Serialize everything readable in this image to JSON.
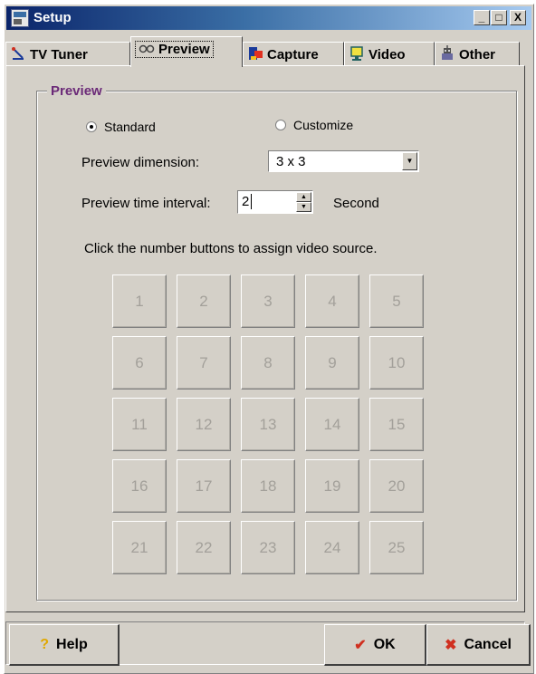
{
  "window": {
    "title": "Setup"
  },
  "titlebar_buttons": {
    "minimize": "_",
    "maximize": "□",
    "close": "X"
  },
  "tabs": [
    {
      "label": "TV Tuner",
      "icon": "antenna-icon",
      "active": false
    },
    {
      "label": "Preview",
      "icon": "glasses-icon",
      "active": true
    },
    {
      "label": "Capture",
      "icon": "capture-icon",
      "active": false
    },
    {
      "label": "Video",
      "icon": "monitor-icon",
      "active": false
    },
    {
      "label": "Other",
      "icon": "robot-icon",
      "active": false
    }
  ],
  "preview": {
    "group_title": "Preview",
    "radio_standard": "Standard",
    "radio_customize": "Customize",
    "selected_mode": "Standard",
    "dimension_label": "Preview dimension:",
    "dimension_value": "3 x 3",
    "interval_label": "Preview time interval:",
    "interval_value": "2",
    "interval_unit": "Second",
    "instruction": "Click the number buttons to assign video source.",
    "buttons": [
      "1",
      "2",
      "3",
      "4",
      "5",
      "6",
      "7",
      "8",
      "9",
      "10",
      "11",
      "12",
      "13",
      "14",
      "15",
      "16",
      "17",
      "18",
      "19",
      "20",
      "21",
      "22",
      "23",
      "24",
      "25"
    ],
    "buttons_enabled": false
  },
  "footer": {
    "help_label": "Help",
    "ok_label": "OK",
    "cancel_label": "Cancel"
  },
  "colors": {
    "title_gradient_start": "#0a246a",
    "title_gradient_end": "#a6caf0",
    "group_title": "#6b2a78",
    "ok_check": "#d03020",
    "cancel_x": "#d03020",
    "help_icon": "#f0c020"
  }
}
